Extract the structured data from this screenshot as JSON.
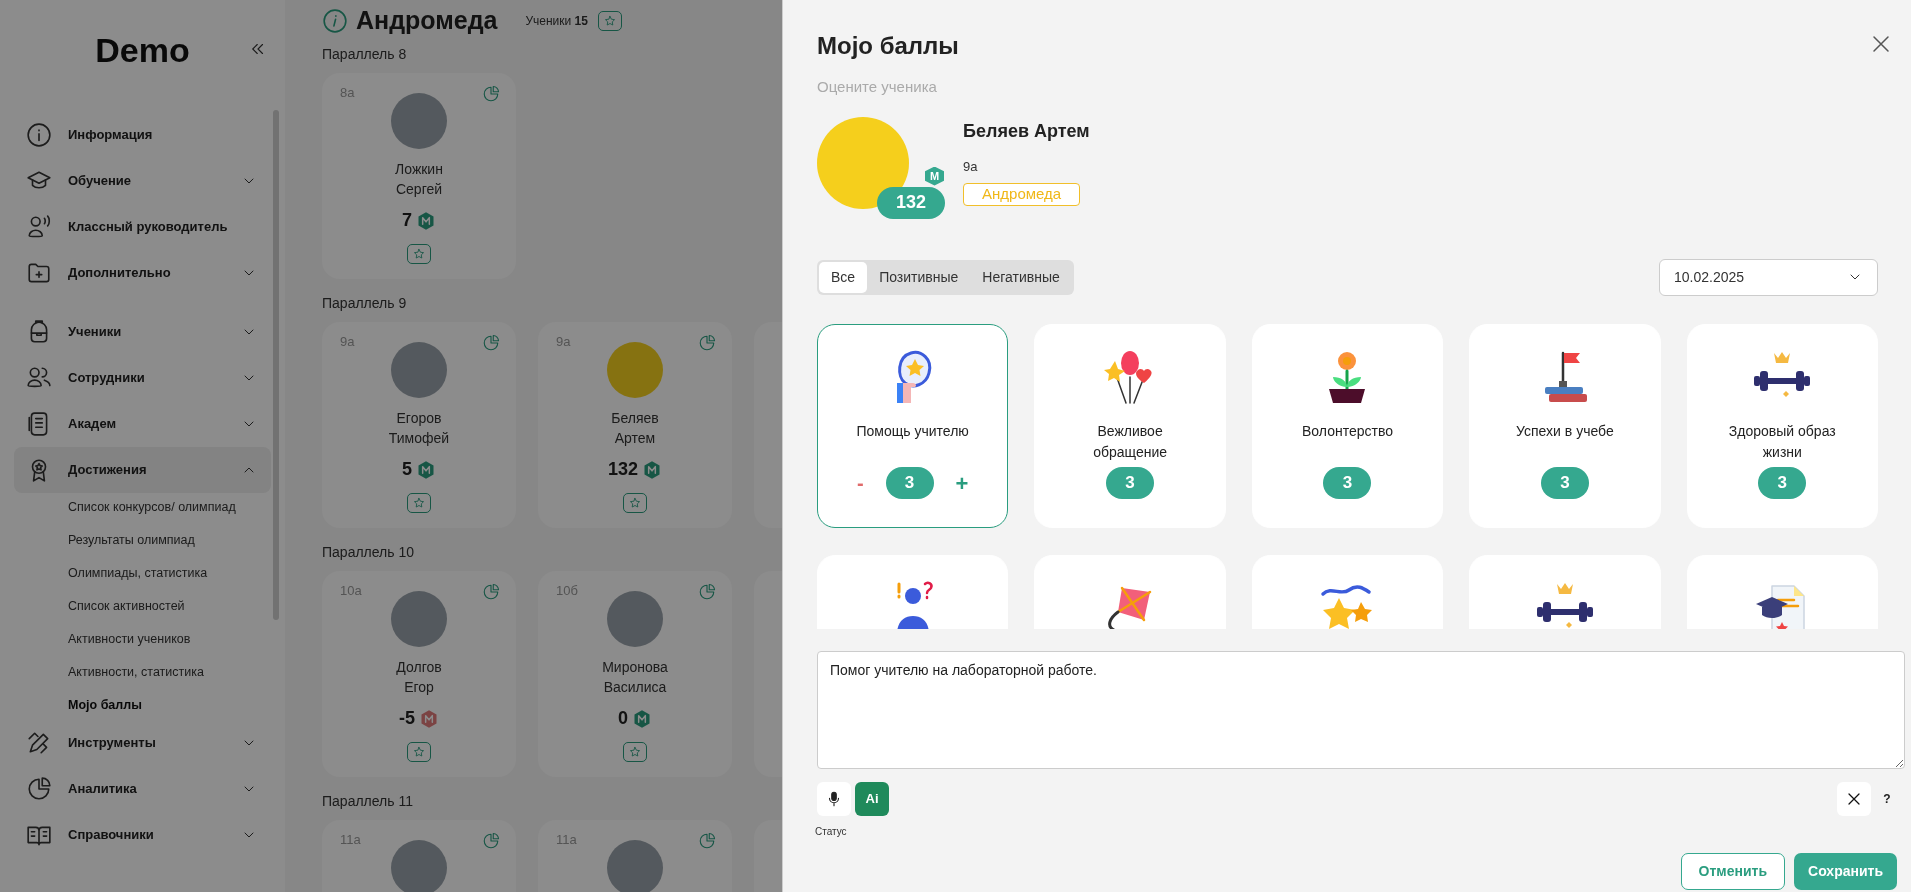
{
  "sidebar": {
    "logo": "Demo",
    "items": [
      {
        "kind": "info",
        "label": "Информация"
      },
      {
        "kind": "cap",
        "label": "Обучение",
        "expanded": false
      },
      {
        "kind": "speaker",
        "label": "Классный руководитель"
      },
      {
        "kind": "folder",
        "label": "Дополнительно",
        "expanded": false
      },
      {
        "kind": "backpack",
        "label": "Ученики",
        "expanded": false
      },
      {
        "kind": "people",
        "label": "Сотрудники",
        "expanded": false
      },
      {
        "kind": "doc",
        "label": "Академ",
        "expanded": false
      },
      {
        "kind": "award",
        "label": "Достижения",
        "expanded": true,
        "children": [
          {
            "label": "Список конкурсов/ олимпиад",
            "selected": false
          },
          {
            "label": "Результаты олимпиад",
            "selected": false
          },
          {
            "label": "Олимпиады, статистика",
            "selected": false
          },
          {
            "label": "Список активностей",
            "selected": false
          },
          {
            "label": "Активности учеников",
            "selected": false
          },
          {
            "label": "Активности, статистика",
            "selected": false
          },
          {
            "label": "Mojo баллы",
            "selected": true
          }
        ]
      },
      {
        "kind": "tools",
        "label": "Инструменты",
        "expanded": false
      },
      {
        "kind": "pie",
        "label": "Аналитика",
        "expanded": false
      },
      {
        "kind": "book",
        "label": "Справочники",
        "expanded": false
      }
    ]
  },
  "main": {
    "title": "Андромеда",
    "students_label": "Ученики",
    "students_count": "15",
    "parallels": [
      {
        "title": "Параллель 8",
        "students": [
          {
            "class": "8а",
            "surname": "Ложкин",
            "given_name": "Сергей",
            "score": "7",
            "negative": false
          }
        ]
      },
      {
        "title": "Параллель 9",
        "students": [
          {
            "class": "9а",
            "surname": "Егоров",
            "given_name": "Тимофей",
            "score": "5",
            "negative": false
          },
          {
            "class": "9а",
            "surname": "Беляев",
            "given_name": "Артем",
            "score": "132",
            "negative": false
          }
        ]
      },
      {
        "title": "Параллель 10",
        "students": [
          {
            "class": "10а",
            "surname": "Долгов",
            "given_name": "Егор",
            "score": "-5",
            "negative": true
          },
          {
            "class": "10б",
            "surname": "Миронова",
            "given_name": "Василиса",
            "score": "0",
            "negative": false
          }
        ]
      },
      {
        "title": "Параллель 11",
        "students": [
          {
            "class": "11а"
          },
          {
            "class": "11а"
          }
        ]
      }
    ]
  },
  "drawer": {
    "title": "Mojo баллы",
    "subtitle": "Оцените ученика",
    "student": {
      "name": "Беляев Артем",
      "class": "9а",
      "group": "Андромеда",
      "score": "132",
      "badge": "M"
    },
    "filter_tabs": [
      {
        "label": "Все",
        "selected": true
      },
      {
        "label": "Позитивные",
        "selected": false
      },
      {
        "label": "Негативные",
        "selected": false
      }
    ],
    "date": "10.02.2025",
    "stepper": {
      "minus": "-",
      "plus": "+"
    },
    "categories": [
      {
        "kind": "helper",
        "label": "Помощь учителю",
        "count": "3",
        "selected": true
      },
      {
        "kind": "balloons",
        "label": "Вежливое обращение",
        "count": "3",
        "selected": false
      },
      {
        "kind": "flower",
        "label": "Волонтерство",
        "count": "3",
        "selected": false
      },
      {
        "kind": "books",
        "label": "Успехи в учебе",
        "count": "3",
        "selected": false
      },
      {
        "kind": "dumbbell",
        "label": "Здоровый образ жизни",
        "count": "3",
        "selected": false
      },
      {
        "kind": "question",
        "selected": false
      },
      {
        "kind": "kite",
        "selected": false
      },
      {
        "kind": "stars",
        "selected": false
      },
      {
        "kind": "dumbbell",
        "selected": false
      },
      {
        "kind": "diploma",
        "selected": false
      }
    ],
    "comment": "Помог учителю на лабораторной работе.",
    "ai_label": "Ai",
    "status_label": "Статус",
    "help_label": "?",
    "buttons": {
      "cancel": "Отменить",
      "save": "Сохранить"
    }
  }
}
